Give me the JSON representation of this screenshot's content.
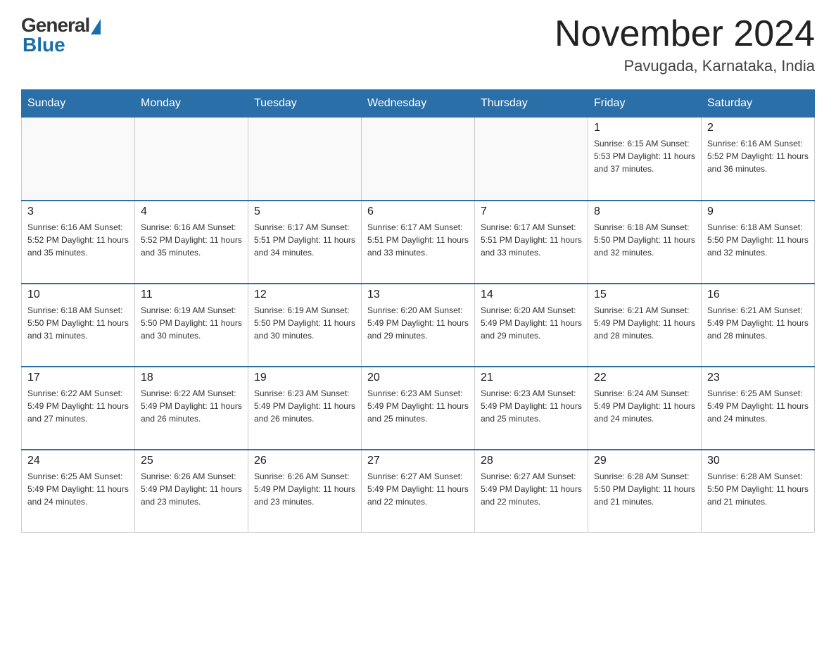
{
  "header": {
    "logo": {
      "general": "General",
      "blue": "Blue"
    },
    "title": "November 2024",
    "location": "Pavugada, Karnataka, India"
  },
  "weekdays": [
    "Sunday",
    "Monday",
    "Tuesday",
    "Wednesday",
    "Thursday",
    "Friday",
    "Saturday"
  ],
  "weeks": [
    [
      {
        "day": "",
        "info": ""
      },
      {
        "day": "",
        "info": ""
      },
      {
        "day": "",
        "info": ""
      },
      {
        "day": "",
        "info": ""
      },
      {
        "day": "",
        "info": ""
      },
      {
        "day": "1",
        "info": "Sunrise: 6:15 AM\nSunset: 5:53 PM\nDaylight: 11 hours and 37 minutes."
      },
      {
        "day": "2",
        "info": "Sunrise: 6:16 AM\nSunset: 5:52 PM\nDaylight: 11 hours and 36 minutes."
      }
    ],
    [
      {
        "day": "3",
        "info": "Sunrise: 6:16 AM\nSunset: 5:52 PM\nDaylight: 11 hours and 35 minutes."
      },
      {
        "day": "4",
        "info": "Sunrise: 6:16 AM\nSunset: 5:52 PM\nDaylight: 11 hours and 35 minutes."
      },
      {
        "day": "5",
        "info": "Sunrise: 6:17 AM\nSunset: 5:51 PM\nDaylight: 11 hours and 34 minutes."
      },
      {
        "day": "6",
        "info": "Sunrise: 6:17 AM\nSunset: 5:51 PM\nDaylight: 11 hours and 33 minutes."
      },
      {
        "day": "7",
        "info": "Sunrise: 6:17 AM\nSunset: 5:51 PM\nDaylight: 11 hours and 33 minutes."
      },
      {
        "day": "8",
        "info": "Sunrise: 6:18 AM\nSunset: 5:50 PM\nDaylight: 11 hours and 32 minutes."
      },
      {
        "day": "9",
        "info": "Sunrise: 6:18 AM\nSunset: 5:50 PM\nDaylight: 11 hours and 32 minutes."
      }
    ],
    [
      {
        "day": "10",
        "info": "Sunrise: 6:18 AM\nSunset: 5:50 PM\nDaylight: 11 hours and 31 minutes."
      },
      {
        "day": "11",
        "info": "Sunrise: 6:19 AM\nSunset: 5:50 PM\nDaylight: 11 hours and 30 minutes."
      },
      {
        "day": "12",
        "info": "Sunrise: 6:19 AM\nSunset: 5:50 PM\nDaylight: 11 hours and 30 minutes."
      },
      {
        "day": "13",
        "info": "Sunrise: 6:20 AM\nSunset: 5:49 PM\nDaylight: 11 hours and 29 minutes."
      },
      {
        "day": "14",
        "info": "Sunrise: 6:20 AM\nSunset: 5:49 PM\nDaylight: 11 hours and 29 minutes."
      },
      {
        "day": "15",
        "info": "Sunrise: 6:21 AM\nSunset: 5:49 PM\nDaylight: 11 hours and 28 minutes."
      },
      {
        "day": "16",
        "info": "Sunrise: 6:21 AM\nSunset: 5:49 PM\nDaylight: 11 hours and 28 minutes."
      }
    ],
    [
      {
        "day": "17",
        "info": "Sunrise: 6:22 AM\nSunset: 5:49 PM\nDaylight: 11 hours and 27 minutes."
      },
      {
        "day": "18",
        "info": "Sunrise: 6:22 AM\nSunset: 5:49 PM\nDaylight: 11 hours and 26 minutes."
      },
      {
        "day": "19",
        "info": "Sunrise: 6:23 AM\nSunset: 5:49 PM\nDaylight: 11 hours and 26 minutes."
      },
      {
        "day": "20",
        "info": "Sunrise: 6:23 AM\nSunset: 5:49 PM\nDaylight: 11 hours and 25 minutes."
      },
      {
        "day": "21",
        "info": "Sunrise: 6:23 AM\nSunset: 5:49 PM\nDaylight: 11 hours and 25 minutes."
      },
      {
        "day": "22",
        "info": "Sunrise: 6:24 AM\nSunset: 5:49 PM\nDaylight: 11 hours and 24 minutes."
      },
      {
        "day": "23",
        "info": "Sunrise: 6:25 AM\nSunset: 5:49 PM\nDaylight: 11 hours and 24 minutes."
      }
    ],
    [
      {
        "day": "24",
        "info": "Sunrise: 6:25 AM\nSunset: 5:49 PM\nDaylight: 11 hours and 24 minutes."
      },
      {
        "day": "25",
        "info": "Sunrise: 6:26 AM\nSunset: 5:49 PM\nDaylight: 11 hours and 23 minutes."
      },
      {
        "day": "26",
        "info": "Sunrise: 6:26 AM\nSunset: 5:49 PM\nDaylight: 11 hours and 23 minutes."
      },
      {
        "day": "27",
        "info": "Sunrise: 6:27 AM\nSunset: 5:49 PM\nDaylight: 11 hours and 22 minutes."
      },
      {
        "day": "28",
        "info": "Sunrise: 6:27 AM\nSunset: 5:49 PM\nDaylight: 11 hours and 22 minutes."
      },
      {
        "day": "29",
        "info": "Sunrise: 6:28 AM\nSunset: 5:50 PM\nDaylight: 11 hours and 21 minutes."
      },
      {
        "day": "30",
        "info": "Sunrise: 6:28 AM\nSunset: 5:50 PM\nDaylight: 11 hours and 21 minutes."
      }
    ]
  ]
}
